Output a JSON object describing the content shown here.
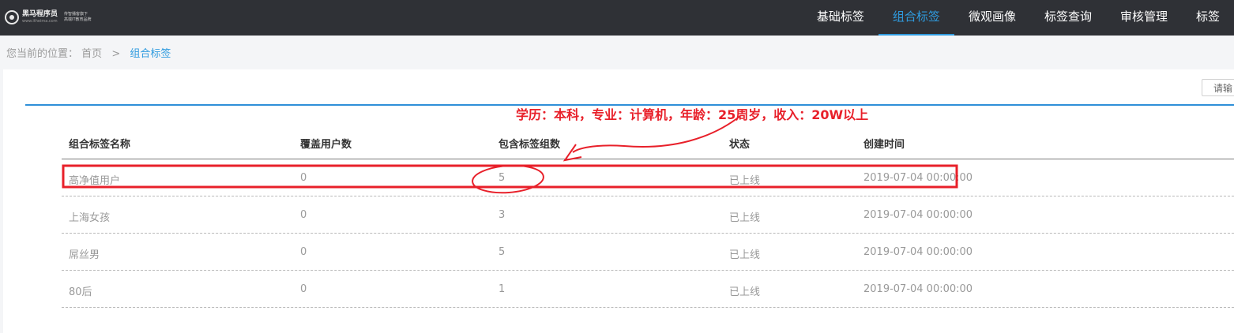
{
  "header": {
    "logo": {
      "name": "黑马程序员",
      "url": "www.itheima.com",
      "slogan": "传智播客旗下 高端IT教育品牌"
    },
    "nav": [
      "基础标签",
      "组合标签",
      "微观画像",
      "标签查询",
      "审核管理",
      "标签"
    ],
    "active_nav": "组合标签"
  },
  "breadcrumb": {
    "prefix": "您当前的位置：",
    "home": "首页",
    "separator": ">",
    "current": "组合标签"
  },
  "search": {
    "value": "请输"
  },
  "table": {
    "columns": [
      "组合标签名称",
      "覆盖用户数",
      "包含标签组数",
      "状态",
      "创建时间"
    ],
    "rows": [
      [
        "高净值用户",
        "0",
        "5",
        "已上线",
        "2019-07-04 00:00:00"
      ],
      [
        "上海女孩",
        "0",
        "3",
        "已上线",
        "2019-07-04 00:00:00"
      ],
      [
        "屌丝男",
        "0",
        "5",
        "已上线",
        "2019-07-04 00:00:00"
      ],
      [
        "80后",
        "0",
        "1",
        "已上线",
        "2019-07-04 00:00:00"
      ]
    ]
  },
  "annotation": {
    "text": "学历：本科，专业：计算机，年龄：25周岁，收入：20W以上",
    "color": "#e8202a"
  },
  "colors": {
    "topbar": "#2f3136",
    "accent": "#2f9bdf",
    "blue_rule": "#2f8fd8"
  }
}
